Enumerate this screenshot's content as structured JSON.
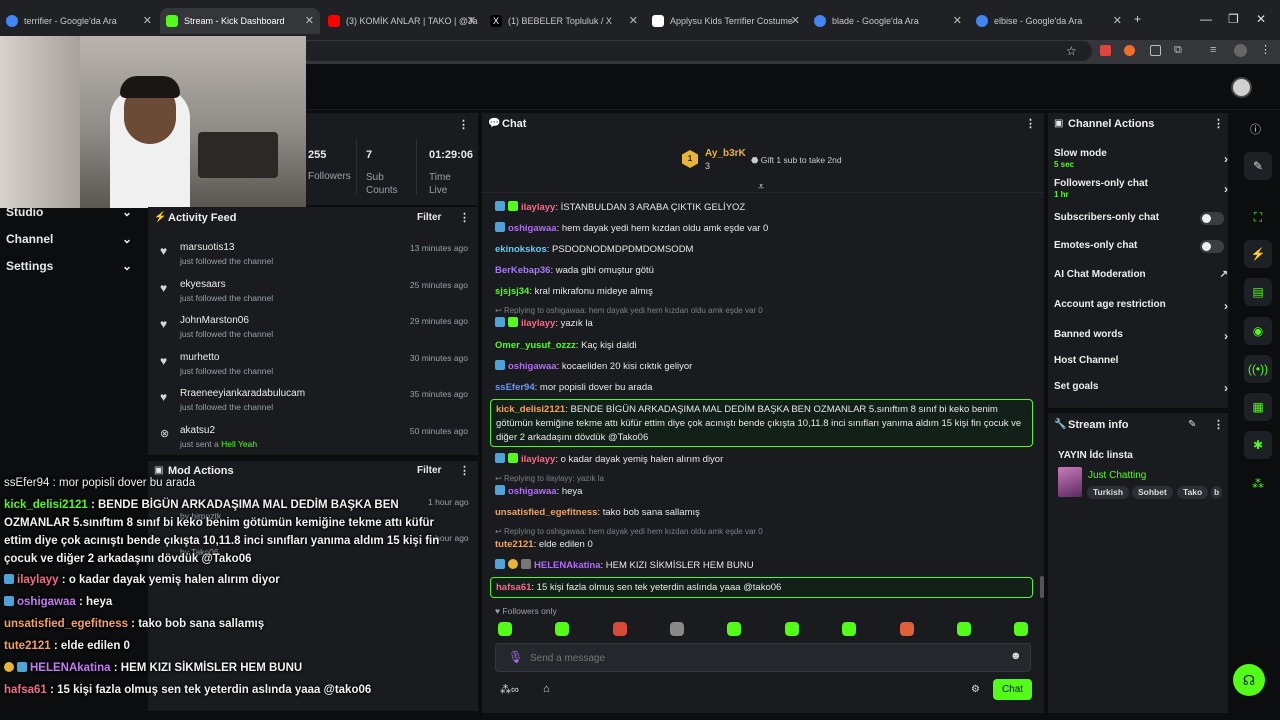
{
  "tabs": [
    {
      "title": "terrifier - Google'da Ara",
      "fav_color": "#4285f4"
    },
    {
      "title": "Stream - Kick Dashboard",
      "fav_color": "#53fc18"
    },
    {
      "title": "(3) KOMİK ANLAR | TAKO | @Ja",
      "fav_color": "#ff0000"
    },
    {
      "title": "(1) BEBELER Topluluk / X",
      "fav_color": "#000000"
    },
    {
      "title": "Applysu Kids Terrifier Costume",
      "fav_color": "#ffffff"
    },
    {
      "title": "blade - Google'da Ara",
      "fav_color": "#4285f4"
    },
    {
      "title": "elbise - Google'da Ara",
      "fav_color": "#4285f4"
    }
  ],
  "stats": [
    {
      "value": "255",
      "label": "Followers"
    },
    {
      "value": "7",
      "label": "Sub Counts"
    },
    {
      "value": "01:29:06",
      "label": "Time Live"
    }
  ],
  "left_nav": [
    "Studio",
    "Channel",
    "Settings"
  ],
  "activity_feed": {
    "title": "Activity Feed",
    "filter": "Filter",
    "items": [
      {
        "name": "marsuotis13",
        "action": "just followed the channel",
        "time": "13 minutes ago"
      },
      {
        "name": "ekyesaars",
        "action": "just followed the channel",
        "time": "25 minutes ago"
      },
      {
        "name": "JohnMarston06",
        "action": "just followed the channel",
        "time": "29 minutes ago"
      },
      {
        "name": "murhetto",
        "action": "just followed the channel",
        "time": "30 minutes ago"
      },
      {
        "name": "Rraeneeyiankaradabulucam",
        "action": "just followed the channel",
        "time": "35 minutes ago"
      },
      {
        "name": "akatsu2",
        "action": "just sent a",
        "gift": "Hell Yeah",
        "time": "50 minutes ago"
      }
    ]
  },
  "mod_actions": {
    "title": "Mod Actions",
    "filter": "Filter",
    "items": [
      {
        "by": "by hirpoztk",
        "time": "1 hour ago"
      },
      {
        "by": "by Tako06",
        "time": "1 hour ago"
      }
    ]
  },
  "chat": {
    "title": "Chat",
    "pinned": {
      "user": "Ay_b3rK",
      "count": "3",
      "rank": "1",
      "gift_text": "Gift 1 sub to take 2nd"
    },
    "messages": [
      {
        "user": "ilaylayy",
        "color": "#f56b8a",
        "text": "İSTANBULDAN 3 ARABA ÇIKTIK GELİYOZ",
        "badges": 2
      },
      {
        "user": "oshigawaa",
        "color": "#b36bf5",
        "text": "hem dayak yedi hem kızdan oldu amk eşde var 0",
        "badges": 1
      },
      {
        "user": "ekinokskos",
        "color": "#6bc7f5",
        "text": "PSDODNODMDPDMDOMSODM",
        "badges": 0
      },
      {
        "user": "BerKebap36",
        "color": "#a27bf5",
        "text": "wada gibi omuştur götü",
        "badges": 0
      },
      {
        "user": "sjsjsj34",
        "color": "#53fc18",
        "text": "kral mikrafonu mideye almış",
        "badges": 0
      },
      {
        "reply": "Replying to oshigawaa: hem dayak yedi hem kızdan oldu amk eşde var 0"
      },
      {
        "user": "ilaylayy",
        "color": "#f56b8a",
        "text": "yazık la",
        "badges": 2
      },
      {
        "user": "Omer_yusuf_ozzz",
        "color": "#53fc18",
        "text": "Kaç kişi daldi",
        "badges": 0
      },
      {
        "user": "oshigawaa",
        "color": "#b36bf5",
        "text": "kocaeliden 20 kisi cıktık geliyor",
        "badges": 1
      },
      {
        "user": "ssEfer94",
        "color": "#6b9af5",
        "text": "mor popisli dover bu arada",
        "badges": 0
      }
    ],
    "highlighted": {
      "user": "kick_delisi2121",
      "text": "BENDE BİGÜN ARKADAŞIMA MAL DEDİM BAŞKA BEN OZMANLAR 5.sınıftım 8 sınıf bi keko benim götümün kemiğine tekme attı küfür ettim diye çok acınıştı bende çıkışta 10,11.8 inci sınıfları yanıma aldım 15 kişi fin çocuk ve diğer 2 arkadaşını dövdük @Tako06"
    },
    "messages2": [
      {
        "user": "ilaylayy",
        "color": "#f56b8a",
        "text": "o kadar dayak yemiş halen alırım diyor",
        "badges": 2
      },
      {
        "reply": "Replying to ilaylayy: yazık la"
      },
      {
        "user": "oshigawaa",
        "color": "#b36bf5",
        "text": "heya",
        "badges": 1
      },
      {
        "user": "unsatisfied_egefitness",
        "color": "#f5a25b",
        "text": "tako bob sana sallamış",
        "badges": 0
      },
      {
        "reply": "Replying to oshigawaa: hem dayak yedi hem kızdan oldu amk eşde var 0"
      },
      {
        "user": "tute2121",
        "color": "#f5a25b",
        "text": "elde edilen 0",
        "badges": 0
      },
      {
        "user": "HELENAkatina",
        "color": "#b36bf5",
        "text": "HEM KIZI SİKMİSLER HEM BUNU",
        "badges": 3
      }
    ],
    "last": {
      "user": "hafsa61",
      "text": "15 kişi fazla olmuş sen tek yeterdin aslında yaaa @tako06"
    },
    "followers_only": "Followers only",
    "placeholder": "Send a message",
    "send_label": "Chat"
  },
  "overlay_chat": [
    {
      "user": "ssEfer94",
      "color": "#9b9fb8",
      "text": "mor popisli dover bu arada"
    },
    {
      "user": "kick_delisi2121",
      "color": "#53fc18",
      "text": "BENDE BİGÜN ARKADAŞIMA MAL DEDİM BAŞKA BEN"
    },
    {
      "text": "OZMANLAR 5.sınıftım 8 sınıf bi keko benim götümün kemiğine tekme attı küfür"
    },
    {
      "text": "ettim diye çok acınıştı bende çıkışta 10,11.8 inci sınıfları yanıma aldım 15 kişi fin"
    },
    {
      "text": "çocuk ve diğer 2 arkadaşını dövdük @Tako06"
    },
    {
      "user": "ilaylayy",
      "color": "#f56b8a",
      "text": "o kadar dayak yemiş halen alırım diyor"
    },
    {
      "user": "oshigawaa",
      "color": "#c37bf5",
      "text": "heya"
    },
    {
      "user": "unsatisfied_egefitness",
      "color": "#f5a25b",
      "text": "tako bob sana sallamış"
    },
    {
      "user": "tute2121",
      "color": "#f5a25b",
      "text": "elde edilen 0"
    },
    {
      "user": "HELENAkatina",
      "color": "#c37bf5",
      "text": "HEM KIZI SİKMİSLER HEM BUNU"
    },
    {
      "user": "hafsa61",
      "color": "#f56b8a",
      "text": "15 kişi fazla olmuş sen tek yeterdin aslında yaaa @tako06"
    }
  ],
  "channel_actions": {
    "title": "Channel Actions",
    "items": [
      {
        "label": "Slow mode",
        "sub": "5 sec",
        "kind": "chevron"
      },
      {
        "label": "Followers-only chat",
        "sub": "1 hr",
        "kind": "chevron"
      },
      {
        "label": "Subscribers-only chat",
        "kind": "toggle"
      },
      {
        "label": "Emotes-only chat",
        "kind": "toggle"
      },
      {
        "label": "AI Chat Moderation",
        "kind": "external"
      },
      {
        "label": "Account age restriction",
        "kind": "chevron"
      },
      {
        "label": "Banned words",
        "kind": "chevron"
      },
      {
        "label": "Host Channel",
        "kind": "none"
      },
      {
        "label": "Set goals",
        "kind": "chevron"
      }
    ]
  },
  "stream_info": {
    "title": "Stream info",
    "stream_title": "YAYIN İdc linsta",
    "category": "Just Chatting",
    "tags": [
      "Turkish",
      "Sohbet",
      "Tako",
      "b"
    ]
  }
}
